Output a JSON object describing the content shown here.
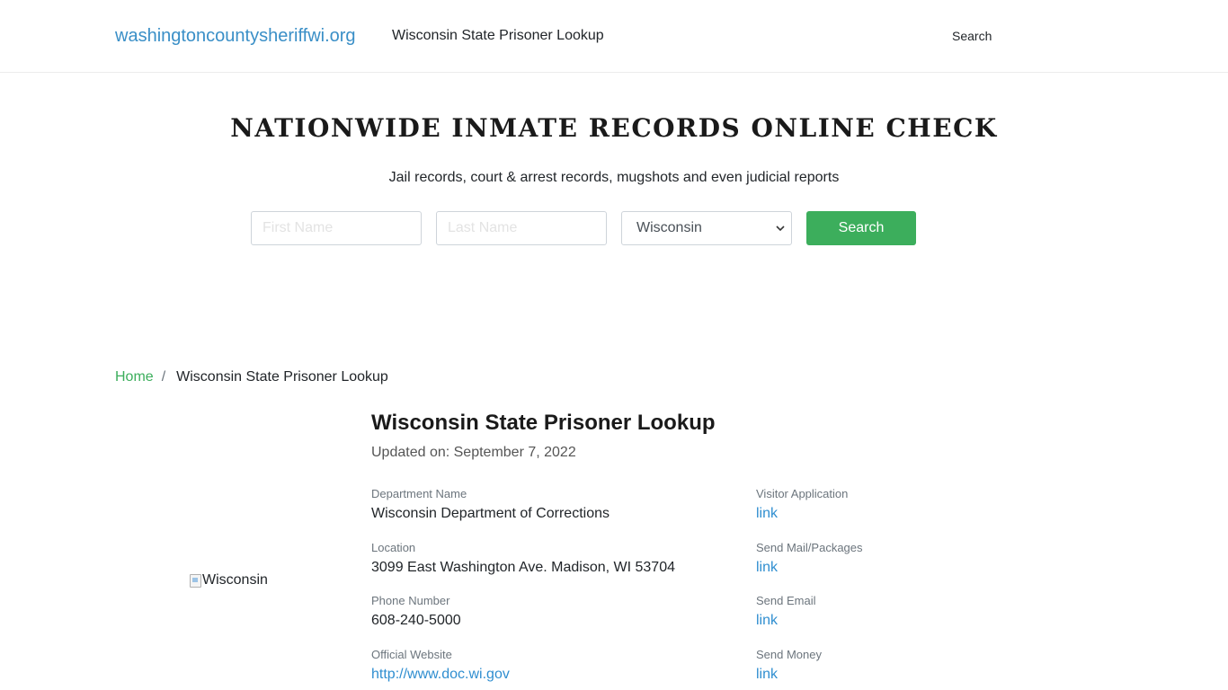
{
  "header": {
    "brand": "washingtoncountysheriffwi.org",
    "nav_title": "Wisconsin State Prisoner Lookup",
    "search_link": "Search"
  },
  "hero": {
    "title": "NATIONWIDE INMATE RECORDS ONLINE CHECK",
    "subtitle": "Jail records, court & arrest records, mugshots and even judicial reports",
    "first_name_placeholder": "First Name",
    "last_name_placeholder": "Last Name",
    "state_selected": "Wisconsin",
    "search_button": "Search"
  },
  "breadcrumb": {
    "home": "Home",
    "separator": "/",
    "current": "Wisconsin State Prisoner Lookup"
  },
  "image_alt": "Wisconsin",
  "main": {
    "title": "Wisconsin State Prisoner Lookup",
    "updated": "Updated on: September 7, 2022",
    "left": [
      {
        "label": "Department Name",
        "value": "Wisconsin Department of Corrections"
      },
      {
        "label": "Location",
        "value": "3099 East Washington Ave. Madison, WI 53704"
      },
      {
        "label": "Phone Number",
        "value": "608-240-5000"
      },
      {
        "label": "Official Website",
        "value": "http://www.doc.wi.gov"
      }
    ],
    "right": [
      {
        "label": "Visitor Application",
        "value": "link"
      },
      {
        "label": "Send Mail/Packages",
        "value": "link"
      },
      {
        "label": "Send Email",
        "value": "link"
      },
      {
        "label": "Send Money",
        "value": "link"
      }
    ]
  },
  "colors": {
    "brand": "#3a8fc7",
    "button": "#3cae5c",
    "link": "#2f8ed0"
  }
}
